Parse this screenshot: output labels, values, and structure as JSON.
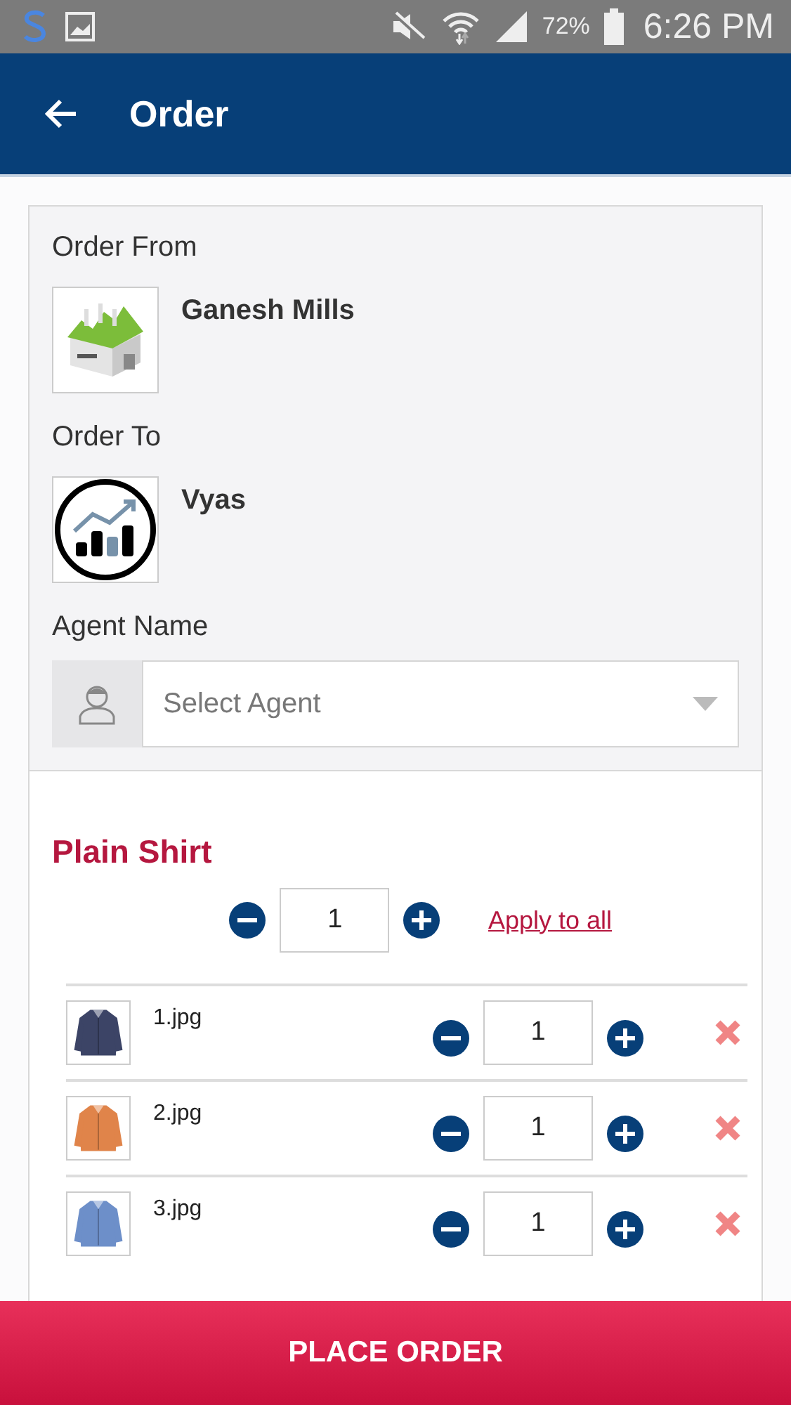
{
  "status_bar": {
    "battery": "72%",
    "time": "6:26 PM"
  },
  "app_bar": {
    "title": "Order"
  },
  "order_from": {
    "label": "Order From",
    "name": "Ganesh Mills"
  },
  "order_to": {
    "label": "Order To",
    "name": "Vyas"
  },
  "agent": {
    "label": "Agent Name",
    "placeholder": "Select Agent"
  },
  "product": {
    "title": "Plain Shirt",
    "quantity": "1",
    "apply_link": "Apply to all"
  },
  "items": [
    {
      "file": "1.jpg",
      "quantity": "1",
      "kind": "picture"
    },
    {
      "file": "2.jpg",
      "quantity": "1",
      "kind": "picture"
    },
    {
      "file": "3.jpg",
      "quantity": "1",
      "kind": "picture"
    }
  ],
  "place_order": "PLACE ORDER"
}
